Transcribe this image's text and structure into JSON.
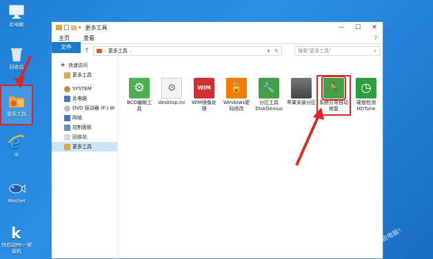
{
  "desktop": {
    "icons": [
      {
        "label": "此电脑"
      },
      {
        "label": "回收站"
      },
      {
        "label": "更多工具"
      },
      {
        "label": "IE"
      },
      {
        "label": "MiniSet"
      },
      {
        "label": "快启动PE一键装机"
      }
    ],
    "watermark": "重启电脑！"
  },
  "window": {
    "title": "更多工具",
    "controls": {
      "minimize": "—",
      "maximize": "☐",
      "close": "✕"
    },
    "ribbon": {
      "file": "文件",
      "home": "主页",
      "view": "查看",
      "help": "?"
    },
    "address": {
      "path": "更多工具",
      "search_placeholder": "搜索\"更多工具\""
    },
    "sidebar": [
      {
        "label": "快速访问",
        "icon": "star-icon",
        "color": "#3a78c2"
      },
      {
        "label": "更多工具",
        "icon": "folder-icon",
        "color": "#e8a33a"
      },
      {
        "label": "SYSTEM",
        "icon": "user-icon",
        "color": "#c08a3a"
      },
      {
        "label": "此电脑",
        "icon": "computer-icon",
        "color": "#3a78c2"
      },
      {
        "label": "DVD 驱动器 (F:) W",
        "icon": "dvd-icon",
        "color": "#888888"
      },
      {
        "label": "网络",
        "icon": "network-icon",
        "color": "#3a78c2"
      },
      {
        "label": "控制面板",
        "icon": "control-panel-icon",
        "color": "#3a78c2"
      },
      {
        "label": "回收站",
        "icon": "recycle-icon",
        "color": "#777777"
      },
      {
        "label": "更多工具",
        "icon": "folder-icon",
        "color": "#e8a33a"
      }
    ],
    "files": [
      {
        "label": "BCD编辑工具",
        "glyph": "⚙",
        "color": "#4caf50"
      },
      {
        "label": "desktop.ini",
        "glyph": "",
        "color": "#eeeeee"
      },
      {
        "label": "WIM镜像处理",
        "glyph": "WIM",
        "color": "#d32f2f"
      },
      {
        "label": "Windows密码修改",
        "glyph": "🔓",
        "color": "#f57c00"
      },
      {
        "label": "分区工具DiskGenius",
        "glyph": "🔧",
        "color": "#43a047"
      },
      {
        "label": "苹果安装分区",
        "glyph": "",
        "color": "#555555"
      },
      {
        "label": "系统引导自动修复",
        "glyph": "🏃",
        "color": "#43a047"
      },
      {
        "label": "硬盘检测HDTune",
        "glyph": "◷",
        "color": "#2e9e3e"
      }
    ]
  }
}
